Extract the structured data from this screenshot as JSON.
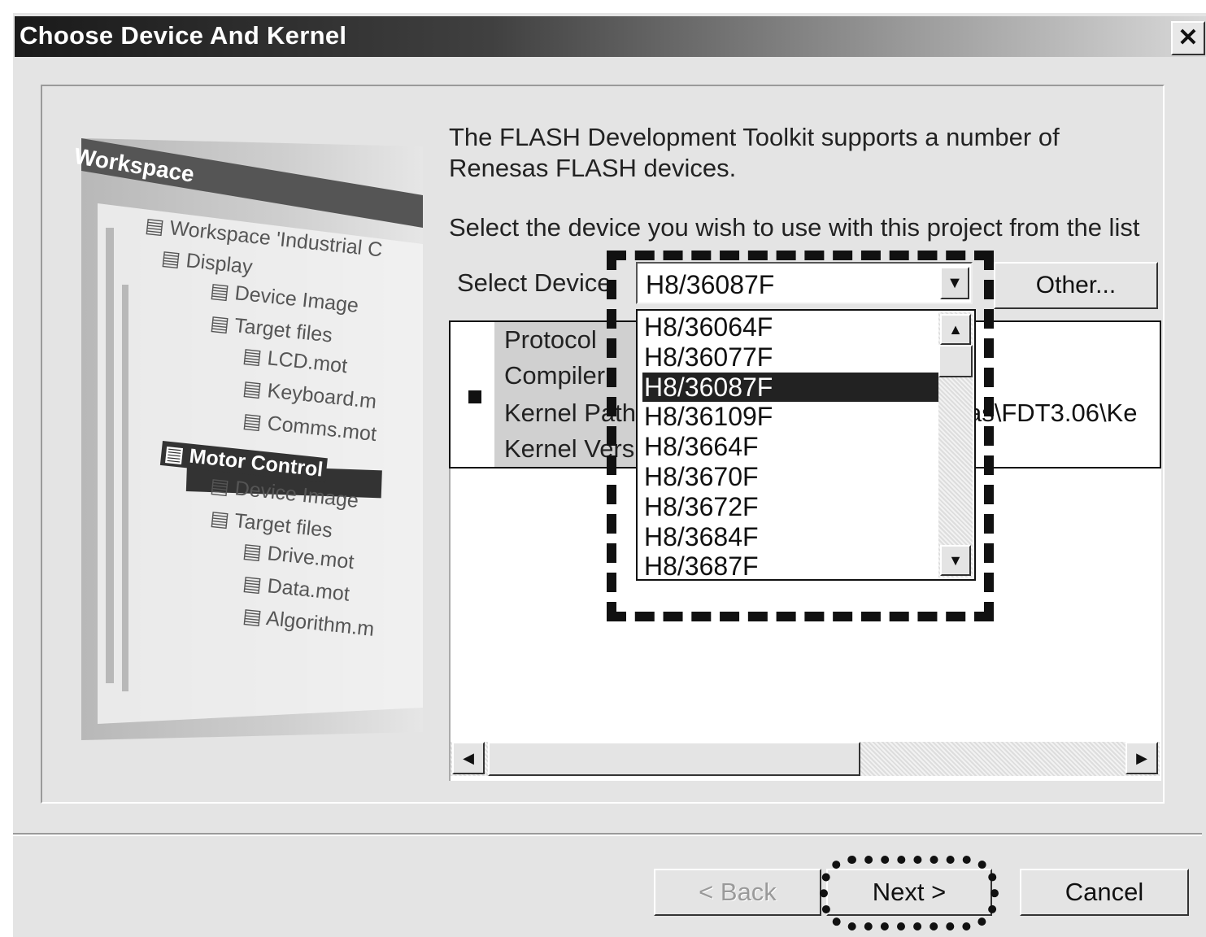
{
  "window": {
    "title": "Choose Device And Kernel",
    "close_label": "✕"
  },
  "illustration": {
    "header": "Workspace",
    "tree": [
      {
        "label": "Workspace 'Industrial C",
        "selected": false
      },
      {
        "label": "Display",
        "selected": false
      },
      {
        "label": "Device Image",
        "selected": false
      },
      {
        "label": "Target files",
        "selected": false
      },
      {
        "label": "LCD.mot",
        "selected": false
      },
      {
        "label": "Keyboard.m",
        "selected": false
      },
      {
        "label": "Comms.mot",
        "selected": false
      },
      {
        "label": "Motor Control",
        "selected": true
      },
      {
        "label": "Device Image",
        "selected": false
      },
      {
        "label": "Target files",
        "selected": false
      },
      {
        "label": "Drive.mot",
        "selected": false
      },
      {
        "label": "Data.mot",
        "selected": false
      },
      {
        "label": "Algorithm.m",
        "selected": false
      }
    ]
  },
  "main": {
    "intro": "The FLASH Development Toolkit supports a number of Renesas FLASH devices.",
    "instruction": "Select the device you wish to use with this project from the list",
    "select_device_label": "Select Device",
    "selected_device": "H8/36087F",
    "other_button": "Other...",
    "info_labels": [
      "Protocol",
      "Compiler",
      "Kernel Path",
      "Kernel Versi"
    ],
    "kernel_path_partial": "as\\FDT3.06\\Ke"
  },
  "dropdown": {
    "options": [
      "H8/36064F",
      "H8/36077F",
      "H8/36087F",
      "H8/36109F",
      "H8/3664F",
      "H8/3670F",
      "H8/3672F",
      "H8/3684F",
      "H8/3687F"
    ],
    "selected_index": 2
  },
  "buttons": {
    "back": "< Back",
    "next": "Next >",
    "cancel": "Cancel"
  }
}
